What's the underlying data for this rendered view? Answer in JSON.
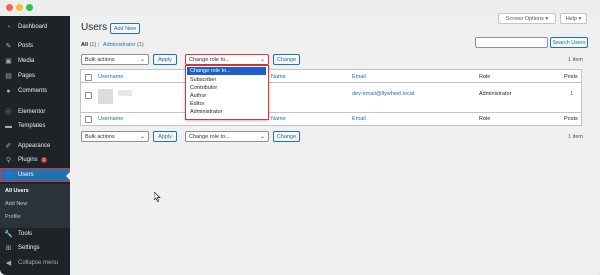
{
  "colors": {
    "sidebar_bg": "#1d2327",
    "accent": "#2271b1",
    "highlight_outline": "#d63638",
    "dropdown_selected": "#1e5fd0"
  },
  "sidebar": {
    "items": [
      {
        "label": "Dashboard",
        "icon": "dashboard-icon"
      },
      {
        "label": "Posts",
        "icon": "pin-icon"
      },
      {
        "label": "Media",
        "icon": "media-icon"
      },
      {
        "label": "Pages",
        "icon": "pages-icon"
      },
      {
        "label": "Comments",
        "icon": "comment-icon"
      },
      {
        "label": "Elementor",
        "icon": "elementor-icon"
      },
      {
        "label": "Templates",
        "icon": "folder-icon"
      },
      {
        "label": "Appearance",
        "icon": "brush-icon"
      },
      {
        "label": "Plugins",
        "icon": "plugin-icon",
        "badge": "1"
      },
      {
        "label": "Users",
        "icon": "user-icon"
      },
      {
        "label": "Tools",
        "icon": "wrench-icon"
      },
      {
        "label": "Settings",
        "icon": "settings-icon"
      },
      {
        "label": "Collapse menu",
        "icon": "collapse-icon"
      }
    ],
    "submenu": [
      "All Users",
      "Add New",
      "Profile"
    ]
  },
  "header": {
    "screen_options": "Screen Options ▾",
    "help": "Help ▾",
    "title": "Users",
    "add_new": "Add New"
  },
  "filters": {
    "all": "All",
    "all_count": "(1)",
    "separator": "|",
    "administrator": "Administrator",
    "administrator_count": "(1)"
  },
  "search": {
    "placeholder": "",
    "button": "Search Users"
  },
  "bulk_top": {
    "bulk_actions": "Bulk actions",
    "apply": "Apply",
    "change_role": "Change role to...",
    "change": "Change",
    "count": "1 item"
  },
  "table": {
    "columns": [
      "Username",
      "Name",
      "Email",
      "Role",
      "Posts"
    ],
    "rows": [
      {
        "email": "dev-email@flywheel.local",
        "role": "Administrator",
        "posts": "1"
      }
    ]
  },
  "dropdown": {
    "options": [
      "Change role to...",
      "Subscriber",
      "Contributor",
      "Author",
      "Editor",
      "Administrator"
    ]
  },
  "bulk_bottom": {
    "bulk_actions": "Bulk actions",
    "apply": "Apply",
    "change_role": "Change role to...",
    "change": "Change",
    "count": "1 item"
  }
}
